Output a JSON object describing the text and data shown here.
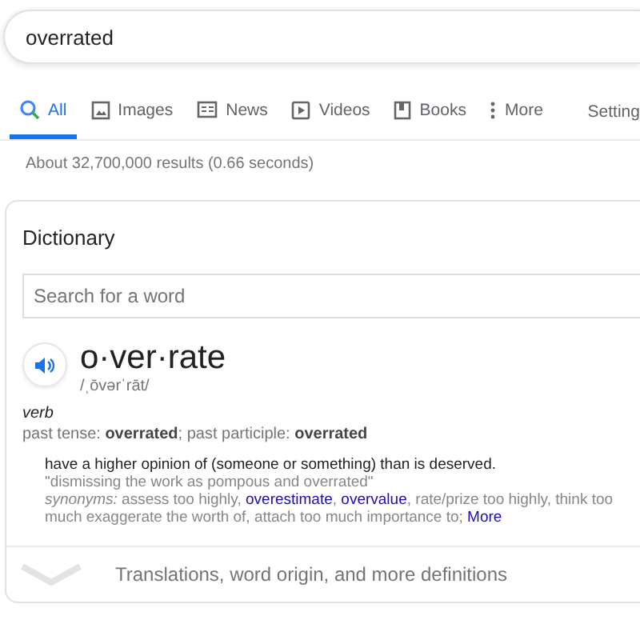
{
  "search": {
    "value": "overrated"
  },
  "tabs": [
    {
      "label": "All",
      "kind": "search",
      "selected": true
    },
    {
      "label": "Images",
      "kind": "image",
      "selected": false
    },
    {
      "label": "News",
      "kind": "news",
      "selected": false
    },
    {
      "label": "Videos",
      "kind": "video",
      "selected": false
    },
    {
      "label": "Books",
      "kind": "book",
      "selected": false
    },
    {
      "label": "More",
      "kind": "more",
      "selected": false
    }
  ],
  "settings": "Setting",
  "result_stats": "About 32,700,000 results (0.66 seconds)",
  "dictionary": {
    "title": "Dictionary",
    "search_placeholder": "Search for a word",
    "word": "o·ver·rate",
    "pronunciation": "/ˌōvərˈrāt/",
    "part_of_speech": "verb",
    "forms": "past tense: **overrated**; past participle: **overrated**",
    "definition": "have a higher opinion of (someone or something) than is deserved.",
    "example": "\"dismissing the work as pompous and overrated\"",
    "synonyms_label": "synonyms:",
    "synonyms": [
      {
        "text": "assess too highly, ",
        "link": false
      },
      {
        "text": "overestimate",
        "link": true
      },
      {
        "text": ", ",
        "link": false
      },
      {
        "text": "overvalue",
        "link": true
      },
      {
        "text": ", rate/prize too highly, think too much exaggerate the worth of, attach too much importance to; ",
        "link": false
      }
    ],
    "more": "More",
    "footer": "Translations, word origin, and more definitions"
  }
}
